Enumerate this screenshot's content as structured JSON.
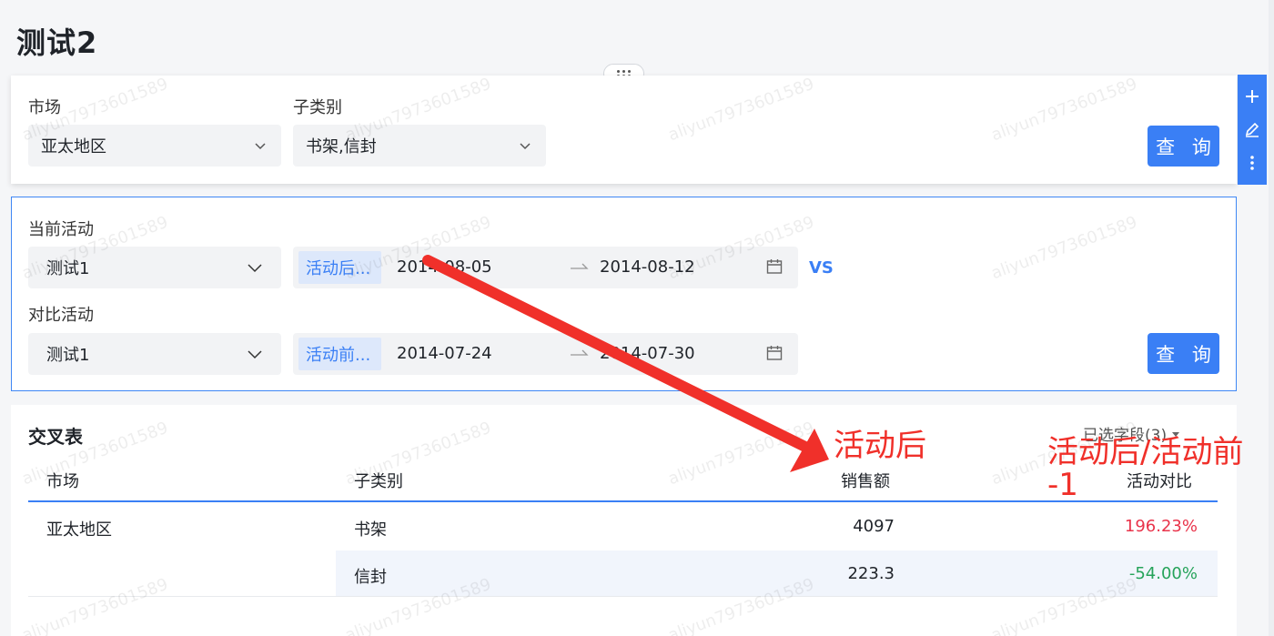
{
  "page": {
    "title": "测试2"
  },
  "filters": {
    "market": {
      "label": "市场",
      "value": "亚太地区"
    },
    "subcategory": {
      "label": "子类别",
      "value": "书架,信封"
    },
    "query_label": "查 询"
  },
  "compare": {
    "current": {
      "label": "当前活动",
      "activity": "测试1",
      "tag": "活动后...",
      "start": "2014-08-05",
      "end": "2014-08-12"
    },
    "vs_label": "VS",
    "baseline": {
      "label": "对比活动",
      "activity": "测试1",
      "tag": "活动前...",
      "start": "2014-07-24",
      "end": "2014-07-30"
    },
    "query_label": "查 询"
  },
  "toolbar": {
    "icons": [
      "plus-icon",
      "edit-icon",
      "more-icon"
    ]
  },
  "table": {
    "title": "交叉表",
    "fields_selector": "已选字段(3)",
    "columns": [
      "市场",
      "子类别",
      "销售额",
      "活动对比"
    ],
    "rows": [
      {
        "market": "亚太地区",
        "subcategory": "书架",
        "sales": "4097",
        "compare": "196.23%"
      },
      {
        "market": "",
        "subcategory": "信封",
        "sales": "223.3",
        "compare": "-54.00%"
      }
    ]
  },
  "annotations": {
    "label1": "活动后",
    "label2_line1": "活动后/活动前",
    "label2_line2": "-1"
  },
  "watermark": "aliyun7973601589",
  "colors": {
    "accent": "#3a7ff5",
    "positive": "#e9334a",
    "negative": "#26a35a",
    "annotation": "#f0302a"
  }
}
